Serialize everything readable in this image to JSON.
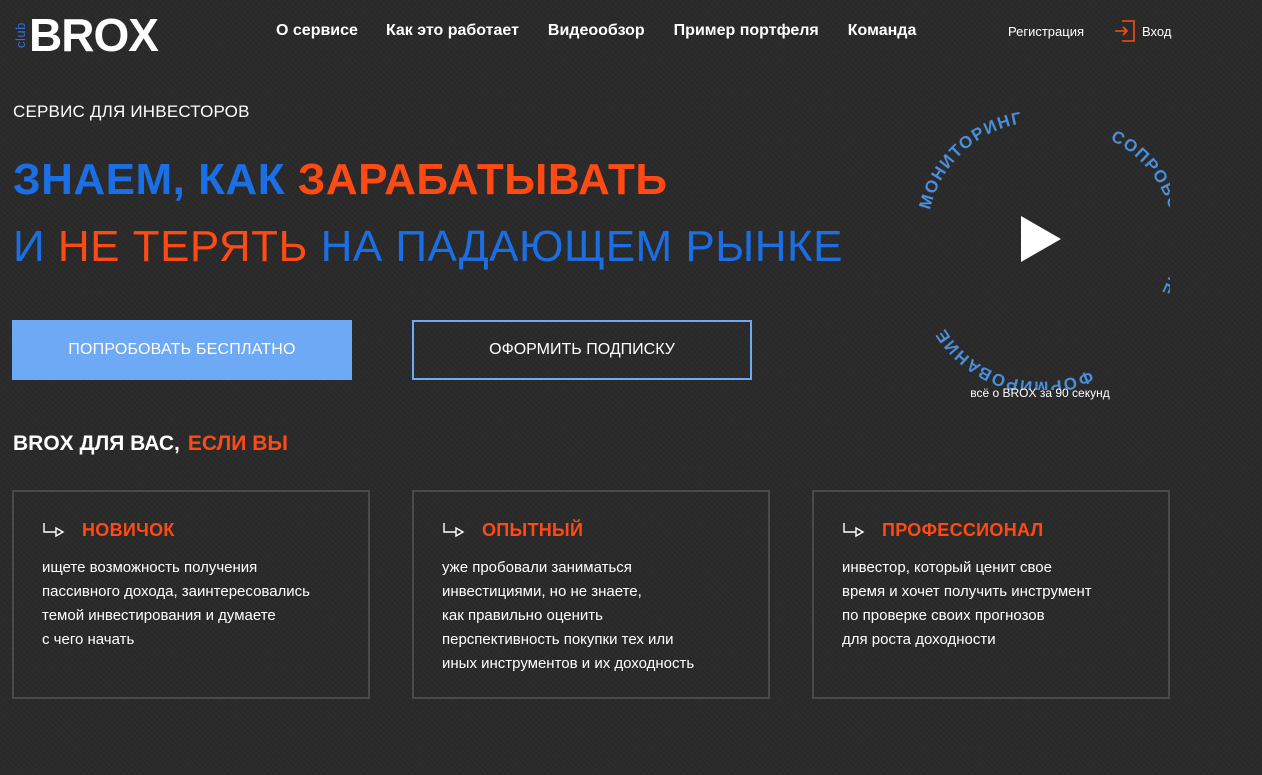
{
  "header": {
    "logo_small": "club",
    "logo_main": "BROX",
    "nav": [
      "О сервисе",
      "Как это работает",
      "Видеообзор",
      "Пример портфеля",
      "Команда"
    ],
    "register": "Регистрация",
    "login": "Вход"
  },
  "hero": {
    "subtitle": "СЕРВИС ДЛЯ ИНВЕСТОРОВ",
    "line1_a": "ЗНАЕМ, КАК ",
    "line1_b": "ЗАРАБАТЫВАТЬ",
    "line2_a": "И ",
    "line2_b": "НЕ ТЕРЯТЬ",
    "line2_c": " НА ПАДАЮЩЕМ РЫНКЕ",
    "btn_try": "ПОПРОБОВАТЬ БЕСПЛАТНО",
    "btn_subscribe": "ОФОРМИТЬ ПОДПИСКУ"
  },
  "video": {
    "word_top": "МОНИТОРИНГ",
    "word_right": "СОПРОВОЖДЕНИЕ",
    "word_bottom": "ФОРМИРОВАНИЕ",
    "caption": "всё о BROX за 90 секунд"
  },
  "section": {
    "title_a": "BROX ДЛЯ ВАС,",
    "title_b": "ЕСЛИ ВЫ",
    "cards": [
      {
        "title": "НОВИЧОК",
        "lines": [
          "ищете возможность получения",
          "пассивного дохода, заинтересовались",
          "темой инвестирования и думаете",
          "с чего начать"
        ]
      },
      {
        "title": "ОПЫТНЫЙ",
        "lines": [
          "уже пробовали заниматься",
          "инвестициями, но не знаете,",
          "как правильно оценить",
          "перспективность покупки тех или",
          "иных инструментов и их доходность"
        ]
      },
      {
        "title": "ПРОФЕССИОНАЛ",
        "lines": [
          "инвестор, который ценит свое",
          "время и хочет получить инструмент",
          "по проверке своих прогнозов",
          "для роста доходности"
        ]
      }
    ]
  },
  "colors": {
    "background": "#2a2a2b",
    "brand_blue": "#1b6fe5",
    "accent_orange": "#ff4a14",
    "button_blue": "#6ea9f5",
    "circle_text": "#4a8fdc"
  },
  "icons": {
    "login": "login-arrow-icon",
    "play": "play-icon",
    "card_arrow": "turn-right-arrow-icon"
  }
}
